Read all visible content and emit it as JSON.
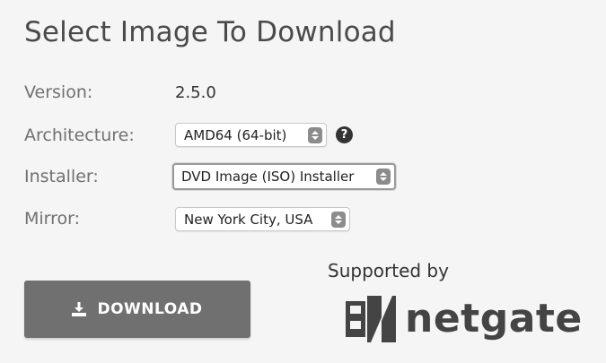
{
  "title": "Select Image To Download",
  "form": {
    "version": {
      "label": "Version:",
      "value": "2.5.0"
    },
    "architecture": {
      "label": "Architecture:",
      "selected": "AMD64 (64-bit)"
    },
    "installer": {
      "label": "Installer:",
      "selected": "DVD Image (ISO) Installer"
    },
    "mirror": {
      "label": "Mirror:",
      "selected": "New York City, USA"
    }
  },
  "help_icon_glyph": "?",
  "download_button": {
    "label": "DOWNLOAD",
    "icon": "download-icon"
  },
  "sponsor": {
    "text": "Supported by",
    "logo_text": "netgate"
  },
  "colors": {
    "button": "#707070",
    "background": "#f5f5f5"
  }
}
